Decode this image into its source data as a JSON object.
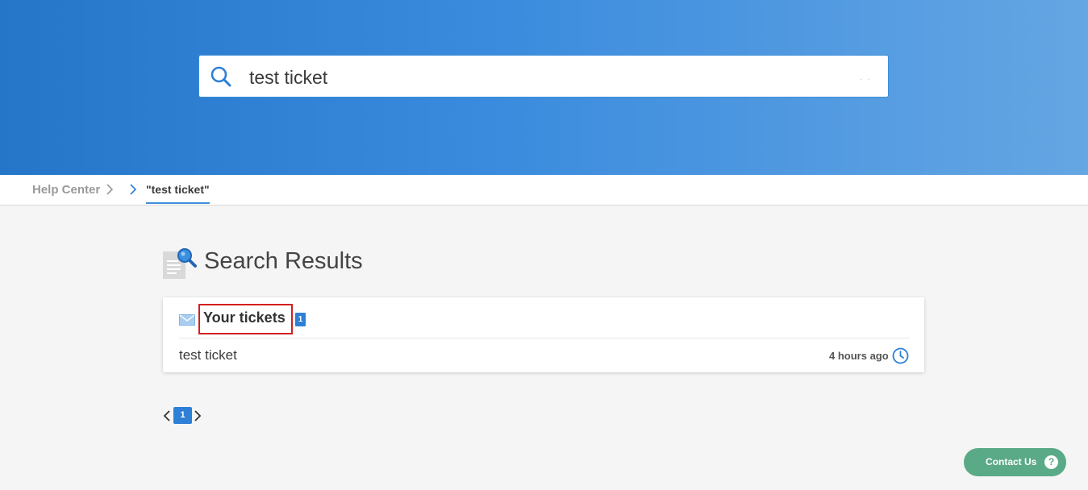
{
  "search": {
    "value": "test ticket",
    "icon": "search-icon",
    "trailing_hint": ". ."
  },
  "breadcrumb": {
    "home": "Help Center",
    "current": "\"test ticket\""
  },
  "results": {
    "title": "Search Results",
    "icon": "search-document-icon",
    "category": {
      "icon": "envelope-icon",
      "title": "Your tickets",
      "count": "1",
      "items": [
        {
          "title": "test ticket",
          "time": "4 hours ago",
          "icon": "clock-icon"
        }
      ]
    }
  },
  "pagination": {
    "current_page": "1"
  },
  "contact": {
    "label": "Contact Us",
    "help_glyph": "?"
  },
  "colors": {
    "accent": "#2e7fd6",
    "hero_start": "#2575c8",
    "hero_end": "#65a6e3",
    "highlight_border": "#d21f1f",
    "contact_bg": "#5aa987"
  }
}
